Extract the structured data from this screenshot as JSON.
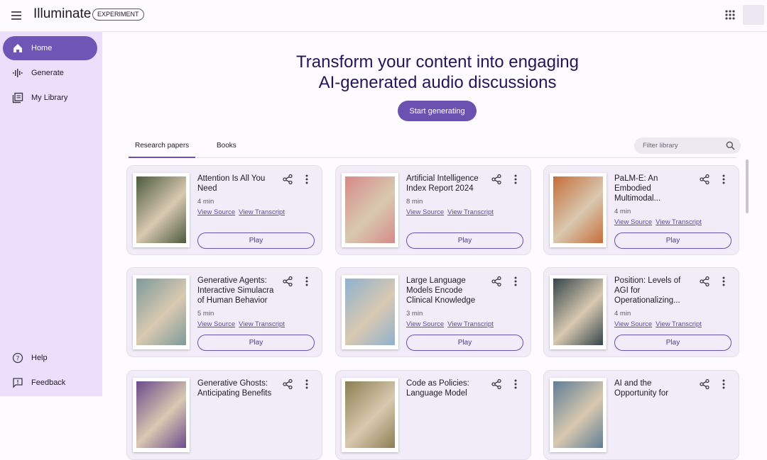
{
  "header": {
    "app_title": "Illuminate",
    "badge": "EXPERIMENT",
    "menu_icon": "menu-icon",
    "apps_icon": "apps-grid-icon"
  },
  "sidebar": {
    "items": [
      {
        "label": "Home",
        "icon": "home-icon",
        "active": true
      },
      {
        "label": "Generate",
        "icon": "waveform-icon"
      },
      {
        "label": "My Library",
        "icon": "library-icon"
      }
    ],
    "bottom": [
      {
        "label": "Help",
        "icon": "help-icon"
      },
      {
        "label": "Feedback",
        "icon": "feedback-icon"
      }
    ]
  },
  "hero": {
    "line1": "Transform your content into engaging",
    "line2": "AI-generated audio discussions",
    "button": "Start generating"
  },
  "tabs": [
    {
      "label": "Research papers",
      "active": true
    },
    {
      "label": "Books"
    }
  ],
  "filter": {
    "placeholder": "Filter library"
  },
  "cards": [
    {
      "title": "Attention Is All You Need",
      "duration": "4 min",
      "view_source": "View Source",
      "view_transcript": "View Transcript",
      "play": "Play",
      "art_color": "#4b5a3e"
    },
    {
      "title": "Artificial Intelligence Index Report 2024",
      "duration": "8 min",
      "view_source": "View Source",
      "view_transcript": "View Transcript",
      "play": "Play",
      "art_color": "#d58a88"
    },
    {
      "title": "PaLM-E: An Embodied Multimodal...",
      "duration": "4 min",
      "view_source": "View Source",
      "view_transcript": "View Transcript",
      "play": "Play",
      "art_color": "#c56d3b"
    },
    {
      "title": "Generative Agents: Interactive Simulacra of Human Behavior",
      "duration": "5 min",
      "view_source": "View Source",
      "view_transcript": "View Transcript",
      "play": "Play",
      "art_color": "#7d9a9a"
    },
    {
      "title": "Large Language Models Encode Clinical Knowledge",
      "duration": "3 min",
      "view_source": "View Source",
      "view_transcript": "View Transcript",
      "play": "Play",
      "art_color": "#8fb1cf"
    },
    {
      "title": "Position: Levels of AGI for Operationalizing...",
      "duration": "4 min",
      "view_source": "View Source",
      "view_transcript": "View Transcript",
      "play": "Play",
      "art_color": "#34464b"
    },
    {
      "title": "Generative Ghosts: Anticipating Benefits",
      "duration": "",
      "view_source": "",
      "view_transcript": "",
      "play": "",
      "art_color": "#6c4a8c"
    },
    {
      "title": "Code as Policies: Language Model",
      "duration": "",
      "view_source": "",
      "view_transcript": "",
      "play": "",
      "art_color": "#8a7f52"
    },
    {
      "title": "AI and the Opportunity for",
      "duration": "",
      "view_source": "",
      "view_transcript": "",
      "play": "",
      "art_color": "#5f7d96"
    }
  ]
}
